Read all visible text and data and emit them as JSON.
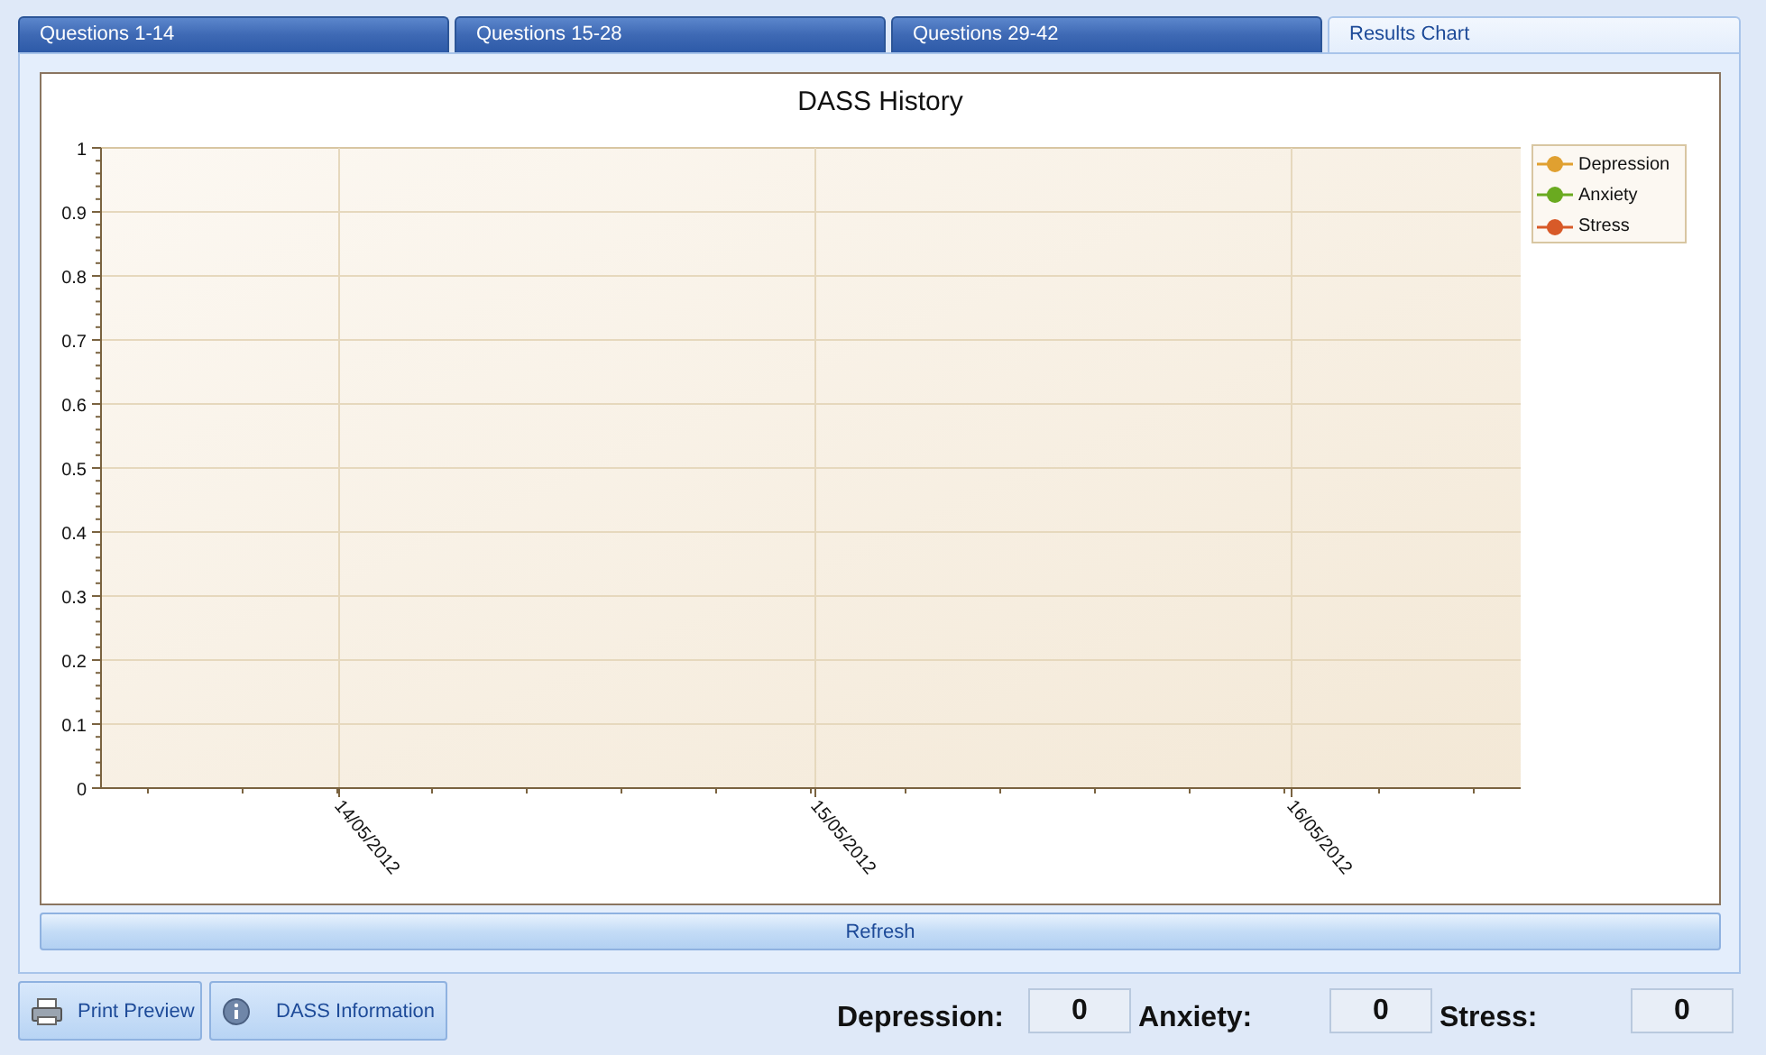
{
  "tabs": [
    {
      "label": "Questions 1-14",
      "selected": false
    },
    {
      "label": "Questions 15-28",
      "selected": false
    },
    {
      "label": "Questions 29-42",
      "selected": false
    },
    {
      "label": "Results Chart",
      "selected": true
    }
  ],
  "chart": {
    "chart_data": {
      "type": "line",
      "grid": true,
      "title": "DASS History",
      "categories": [
        "14/05/2012",
        "15/05/2012",
        "16/05/2012"
      ],
      "ylim": [
        0,
        1
      ],
      "yticks": [
        0,
        0.1,
        0.2,
        0.3,
        0.4,
        0.5,
        0.6,
        0.7,
        0.8,
        0.9,
        1
      ],
      "series": [
        {
          "name": "Depression",
          "color": "#e0a030",
          "values": [
            null,
            null,
            null
          ]
        },
        {
          "name": "Anxiety",
          "color": "#6aaa20",
          "values": [
            null,
            null,
            null
          ]
        },
        {
          "name": "Stress",
          "color": "#d85a28",
          "values": [
            null,
            null,
            null
          ]
        }
      ]
    }
  },
  "refresh_button": "Refresh",
  "buttons": [
    {
      "kind": "print",
      "label": "Print Preview"
    },
    {
      "kind": "info",
      "label": "DASS Information"
    }
  ],
  "scores": [
    {
      "label": "Depression:",
      "value": "0"
    },
    {
      "label": "Anxiety:",
      "value": "0"
    },
    {
      "label": "Stress:",
      "value": "0"
    }
  ]
}
